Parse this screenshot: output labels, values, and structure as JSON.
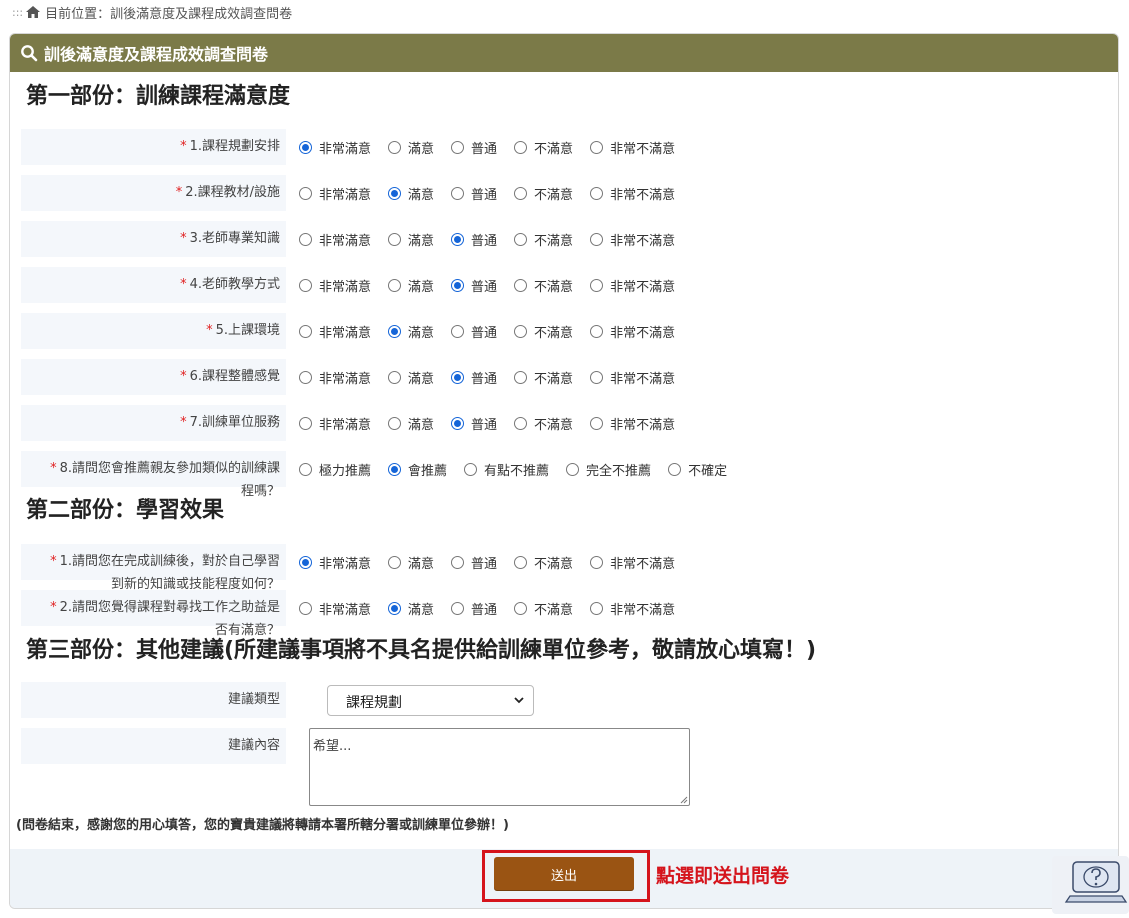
{
  "breadcrumb": {
    "dots": ":::",
    "text": "目前位置：訓後滿意度及課程成效調查問卷"
  },
  "panel_title": "訓後滿意度及課程成效調查問卷",
  "colors": {
    "header": "#7b7a48",
    "radio_selected": "#1565d8",
    "submit": "#9a5413",
    "annotation": "#d5141c"
  },
  "section1": {
    "title": "第一部份：訓練課程滿意度",
    "options": [
      "非常滿意",
      "滿意",
      "普通",
      "不滿意",
      "非常不滿意"
    ],
    "questions": [
      {
        "label": "1.課程規劃安排",
        "selected": "非常滿意"
      },
      {
        "label": "2.課程教材/設施",
        "selected": "滿意"
      },
      {
        "label": "3.老師專業知識",
        "selected": "普通"
      },
      {
        "label": "4.老師教學方式",
        "selected": "普通"
      },
      {
        "label": "5.上課環境",
        "selected": "滿意"
      },
      {
        "label": "6.課程整體感覺",
        "selected": "普通"
      },
      {
        "label": "7.訓練單位服務",
        "selected": "普通"
      }
    ],
    "q8": {
      "label_line1": "8.請問您會推薦親友參加類似的訓練課",
      "label_line2": "程嗎？",
      "options": [
        "極力推薦",
        "會推薦",
        "有點不推薦",
        "完全不推薦",
        "不確定"
      ],
      "selected": "會推薦"
    }
  },
  "section2": {
    "title": "第二部份：學習效果",
    "options": [
      "非常滿意",
      "滿意",
      "普通",
      "不滿意",
      "非常不滿意"
    ],
    "questions": [
      {
        "label_line1": "1.請問您在完成訓練後，對於自己學習",
        "label_line2": "到新的知識或技能程度如何？",
        "selected": "非常滿意"
      },
      {
        "label_line1": "2.請問您覺得課程對尋找工作之助益是",
        "label_line2": "否有滿意？",
        "selected": "滿意"
      }
    ]
  },
  "section3": {
    "title": "第三部份：其他建議(所建議事項將不具名提供給訓練單位參考，敬請放心填寫！)",
    "type_label": "建議類型",
    "type_value": "課程規劃",
    "content_label": "建議內容",
    "content_value": "希望..."
  },
  "end_note": "(問卷結束，感謝您的用心填答，您的寶貴建議將轉請本署所轄分署或訓練單位參辦！)",
  "submit_label": "送出",
  "annotation": "點選即送出問卷",
  "required_mark": "*"
}
